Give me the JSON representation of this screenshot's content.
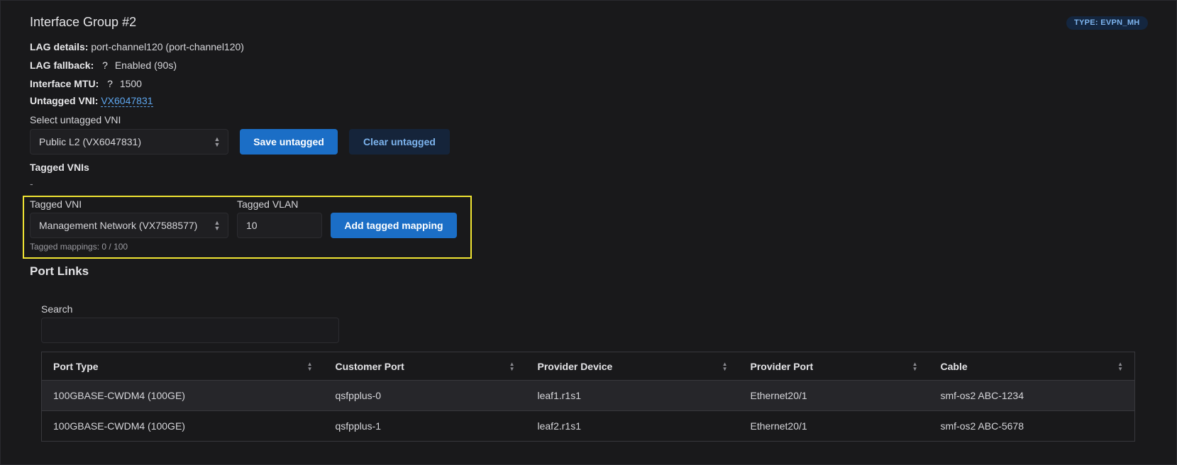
{
  "group": {
    "title": "Interface Group #2",
    "type_badge": "TYPE: EVPN_MH"
  },
  "details": {
    "lag_details_label": "LAG details:",
    "lag_details_value": "port-channel120 (port-channel120)",
    "lag_fallback_label": "LAG fallback:",
    "lag_fallback_help": "?",
    "lag_fallback_value": "Enabled (90s)",
    "mtu_label": "Interface MTU:",
    "mtu_help": "?",
    "mtu_value": "1500",
    "untagged_vni_label": "Untagged VNI:",
    "untagged_vni_value": "VX6047831"
  },
  "untagged": {
    "select_label": "Select untagged VNI",
    "selected": "Public L2 (VX6047831)",
    "save_label": "Save untagged",
    "clear_label": "Clear untagged"
  },
  "tagged": {
    "heading": "Tagged VNIs",
    "empty": "-",
    "vni_label": "Tagged VNI",
    "vni_selected": "Management Network (VX7588577)",
    "vlan_label": "Tagged VLAN",
    "vlan_value": "10",
    "add_label": "Add tagged mapping",
    "mappings_count": "Tagged mappings: 0 / 100"
  },
  "port_links": {
    "title": "Port Links",
    "search_label": "Search",
    "search_value": "",
    "columns": [
      "Port Type",
      "Customer Port",
      "Provider Device",
      "Provider Port",
      "Cable"
    ],
    "rows": [
      [
        "100GBASE-CWDM4 (100GE)",
        "qsfpplus-0",
        "leaf1.r1s1",
        "Ethernet20/1",
        "smf-os2 ABC-1234"
      ],
      [
        "100GBASE-CWDM4 (100GE)",
        "qsfpplus-1",
        "leaf2.r1s1",
        "Ethernet20/1",
        "smf-os2 ABC-5678"
      ]
    ]
  },
  "colors": {
    "accent": "#1b6ec6",
    "highlight": "#f0e433",
    "link": "#5ea6ee"
  }
}
